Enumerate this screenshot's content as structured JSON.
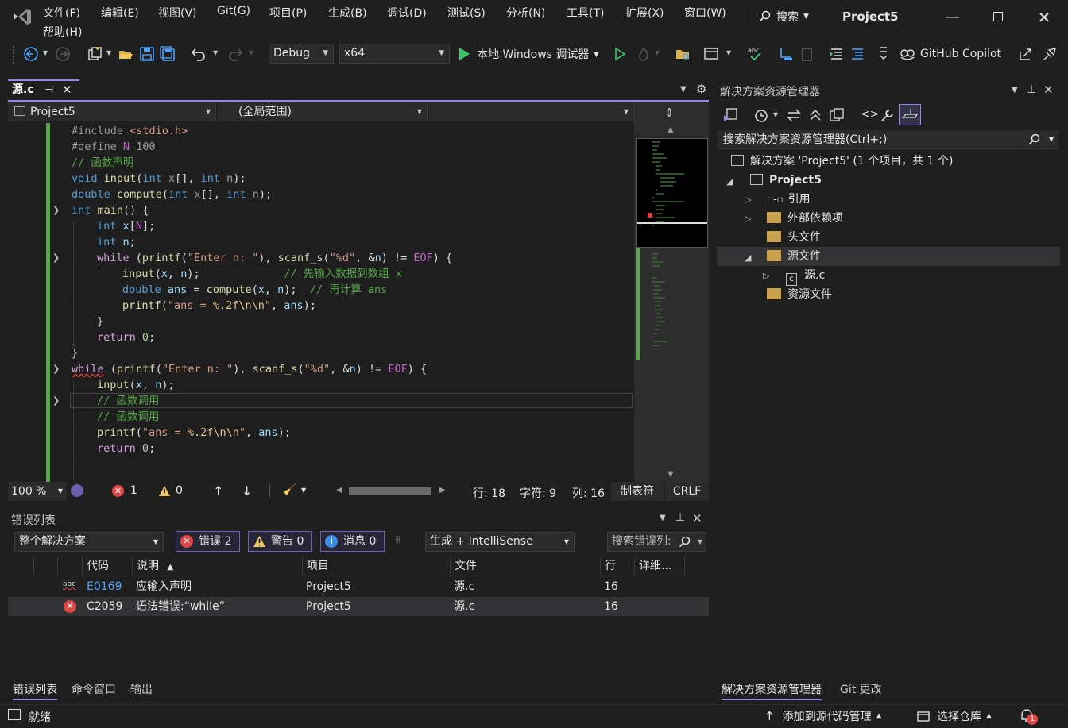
{
  "menu": [
    "文件(F)",
    "编辑(E)",
    "视图(V)",
    "Git(G)",
    "项目(P)",
    "生成(B)",
    "调试(D)",
    "测试(S)",
    "分析(N)",
    "工具(T)",
    "扩展(X)",
    "窗口(W)",
    "帮助(H)"
  ],
  "search_label": "搜索",
  "project_title": "Project5",
  "toolbar": {
    "config": "Debug",
    "platform": "x64",
    "run_label": "本地 Windows 调试器",
    "copilot": "GitHub Copilot"
  },
  "editor": {
    "tab_label": "源.c",
    "nav_project": "Project5",
    "nav_scope": "(全局范围)",
    "zoom": "100 %",
    "errors": "1",
    "warnings": "0",
    "line": "行: 18",
    "char": "字符: 9",
    "col": "列: 16",
    "tabs": "制表符",
    "eol": "CRLF"
  },
  "code_lines": [
    "#include <stdio.h>",
    "#define N 100",
    "// 函数声明",
    "void input(int x[], int n);",
    "double compute(int x[], int n);",
    "int main() {",
    "int x[N];",
    "int n;",
    "while (printf(\"Enter n: \"), scanf_s(\"%d\", &n) != EOF) {",
    "input(x, n);",
    "// 先输入数据到数组 x",
    "double ans = compute(x, n);",
    "// 再计算 ans",
    "printf(\"ans = %.2f\\n\\n\", ans);",
    "}",
    "return 0;",
    "}",
    "while (printf(\"Enter n: \"), scanf_s(\"%d\", &n) != EOF) {",
    "input(x, n);",
    "// 函数调用",
    "// 函数调用",
    "printf(\"ans = %.2f\\n\\n\", ans);",
    "return 0;"
  ],
  "error_list": {
    "title": "错误列表",
    "scope": "整个解决方案",
    "errors_btn": "错误 2",
    "warnings_btn": "警告 0",
    "messages_btn": "消息 0",
    "source": "生成 + IntelliSense",
    "search_placeholder": "搜索错误列:",
    "headers": [
      "代码",
      "说明",
      "项目",
      "文件",
      "行",
      "详细..."
    ],
    "rows": [
      {
        "code": "E0169",
        "desc": "应输入声明",
        "project": "Project5",
        "file": "源.c",
        "line": "16"
      },
      {
        "code": "C2059",
        "desc": "语法错误:“while”",
        "project": "Project5",
        "file": "源.c",
        "line": "16"
      }
    ],
    "bottom_tabs": [
      "错误列表",
      "命令窗口",
      "输出"
    ]
  },
  "solution_explorer": {
    "title": "解决方案资源管理器",
    "search_placeholder": "搜索解决方案资源管理器(Ctrl+;)",
    "solution": "解决方案 'Project5' (1 个项目，共 1 个)",
    "project": "Project5",
    "references": "引用",
    "external_deps": "外部依赖项",
    "headers": "头文件",
    "sources": "源文件",
    "source_file": "源.c",
    "resources": "资源文件",
    "bottom_tabs": [
      "解决方案资源管理器",
      "Git 更改"
    ]
  },
  "status": {
    "ready": "就绪",
    "add_source": "添加到源代码管理",
    "select_repo": "选择仓库",
    "notif_count": "1"
  }
}
